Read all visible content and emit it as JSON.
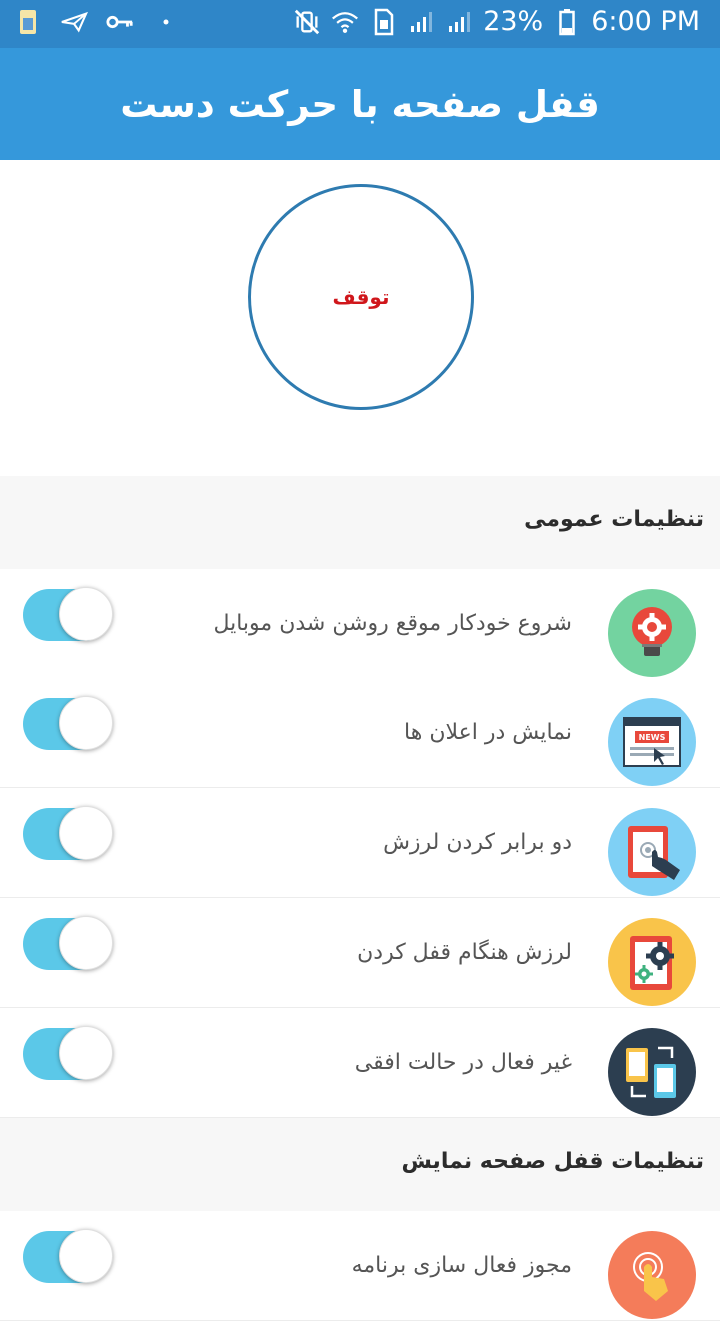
{
  "status_bar": {
    "battery": "23%",
    "time": "6:00 PM"
  },
  "app_bar": {
    "title": "قفل صفحه با حرکت دست"
  },
  "main": {
    "stop_button_label": "توقف"
  },
  "sections": [
    {
      "title": "تنظیمات عمومی",
      "items": [
        {
          "label": "شروع خودکار موقع روشن شدن موبایل",
          "icon": "lightbulb-gear-icon",
          "icon_bg": "#73d3a0",
          "enabled": true
        },
        {
          "label": "نمایش در اعلان ها",
          "icon": "news-browser-icon",
          "icon_bg": "#7fd0f5",
          "enabled": true
        },
        {
          "label": "دو برابر کردن لرزش",
          "icon": "tablet-touch-icon",
          "icon_bg": "#7fd0f5",
          "enabled": true
        },
        {
          "label": "لرزش هنگام قفل کردن",
          "icon": "tablet-gears-icon",
          "icon_bg": "#f9c44a",
          "enabled": true
        },
        {
          "label": "غیر فعال در حالت افقی",
          "icon": "rotate-devices-icon",
          "icon_bg": "#2c3e50",
          "enabled": true
        }
      ]
    },
    {
      "title": "تنظیمات قفل صفحه نمایش",
      "items": [
        {
          "label": "مجوز فعال سازی برنامه",
          "icon": "tap-permission-icon",
          "icon_bg": "#f47c5a",
          "enabled": true
        }
      ]
    }
  ],
  "colors": {
    "status_bar": "#2f86c8",
    "app_bar": "#3598db",
    "toggle_on": "#5bc8e8",
    "stop_text": "#d0161b"
  }
}
